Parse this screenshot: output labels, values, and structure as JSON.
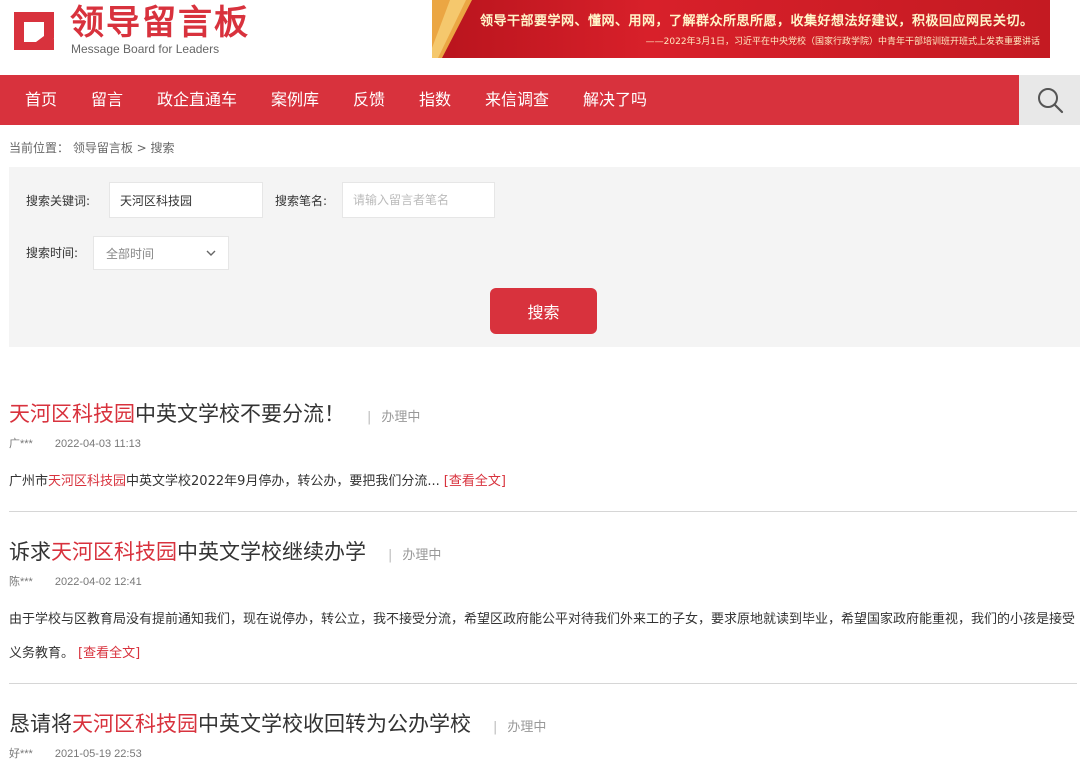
{
  "header": {
    "logo_title": "领导留言板",
    "logo_sub": "Message Board for Leaders",
    "banner_main": "领导干部要学网、懂网、用网，了解群众所思所愿，收集好想法好建议，积极回应网民关切。",
    "banner_sub": "——2022年3月1日，习近平在中央党校（国家行政学院）中青年干部培训班开班式上发表重要讲话"
  },
  "nav": {
    "items": [
      "首页",
      "留言",
      "政企直通车",
      "案例库",
      "反馈",
      "指数",
      "来信调查",
      "解决了吗"
    ],
    "search_icon": "search-icon"
  },
  "breadcrumb": "当前位置： 领导留言板 > 搜索",
  "search": {
    "keyword_label": "搜索关键词:",
    "keyword_value": "天河区科技园",
    "author_label": "搜索笔名:",
    "author_placeholder": "请输入留言者笔名",
    "time_label": "搜索时间:",
    "time_value": "全部时间",
    "button": "搜索"
  },
  "highlight": "天河区科技园",
  "results": [
    {
      "title_pre": "",
      "title_post": "中英文学校不要分流！",
      "status": "办理中",
      "author": "广***",
      "date": "2022-04-03 11:13",
      "body_pre": "广州市",
      "body_post": "中英文学校2022年9月停办，转公办，要把我们分流...",
      "more": "[查看全文]"
    },
    {
      "title_pre": "诉求",
      "title_post": "中英文学校继续办学",
      "status": "办理中",
      "author": "陈***",
      "date": "2022-04-02 12:41",
      "body_pre": "",
      "body_post": "由于学校与区教育局没有提前通知我们，现在说停办，转公立，我不接受分流，希望区政府能公平对待我们外来工的子女，要求原地就读到毕业，希望国家政府能重视，我们的小孩是接受义务教育。",
      "more": "[查看全文]"
    },
    {
      "title_pre": "恳请将",
      "title_post": "中英文学校收回转为公办学校",
      "status": "办理中",
      "author": "好***",
      "date": "2021-05-19 22:53"
    }
  ],
  "colors": {
    "brand": "#d8323d",
    "panel": "#f4f4f4"
  }
}
